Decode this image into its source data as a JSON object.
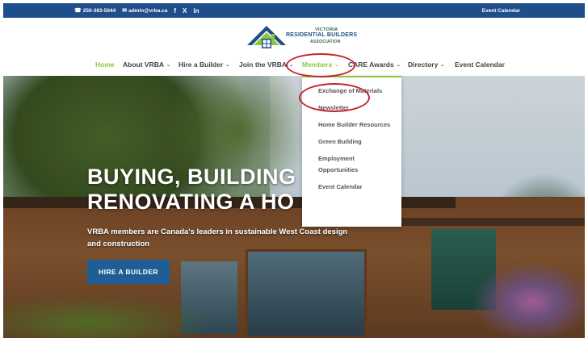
{
  "topbar": {
    "phone": "250-383-5044",
    "email": "admin@vrba.ca",
    "social": [
      "f",
      "X",
      "in"
    ],
    "right_link": "Event Calendar",
    "bg_color": "#1f4e8a"
  },
  "logo": {
    "line1": "VICTORIA",
    "line2": "RESIDENTIAL BUILDERS",
    "line3": "ASSOCIATION"
  },
  "nav": {
    "items": [
      {
        "label": "Home",
        "has_chevron": false
      },
      {
        "label": "About VRBA",
        "has_chevron": true
      },
      {
        "label": "Hire a Builder",
        "has_chevron": true
      },
      {
        "label": "Join the VRBA",
        "has_chevron": true
      },
      {
        "label": "Members",
        "has_chevron": true
      },
      {
        "label": "CARE Awards",
        "has_chevron": true
      },
      {
        "label": "Directory",
        "has_chevron": true
      },
      {
        "label": "Event Calendar",
        "has_chevron": false
      }
    ],
    "active_color": "#8cc63f"
  },
  "dropdown": {
    "items": [
      "Exchange of Materials",
      "Newsletter",
      "Home Builder Resources",
      "Green Building",
      "Employment Opportunities",
      "Event Calendar"
    ]
  },
  "hero": {
    "headline_line1": "BUYING, BUILDING",
    "headline_line2": "RENOVATING A HO",
    "subtext": "VRBA members are Canada's leaders in sustainable West Coast design and construction",
    "cta_label": "HIRE A BUILDER",
    "cta_color": "#1f5d96"
  },
  "annotation_color": "#c4252a"
}
